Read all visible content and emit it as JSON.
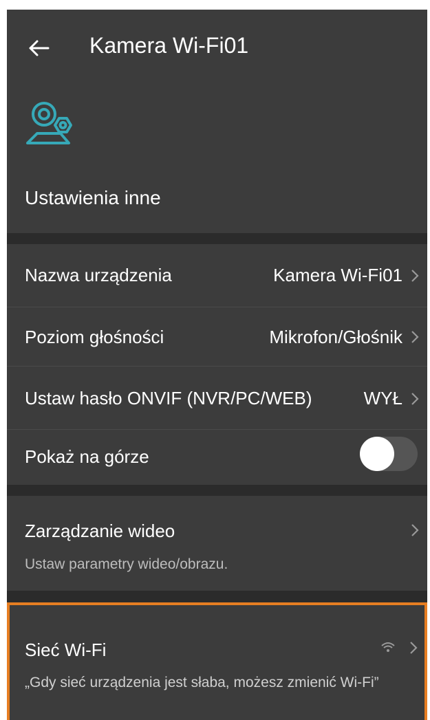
{
  "header": {
    "title": "Kamera Wi-Fi01"
  },
  "section": {
    "title": "Ustawienia inne"
  },
  "rows": [
    {
      "label": "Nazwa urządzenia",
      "value": "Kamera Wi-Fi01"
    },
    {
      "label": "Poziom głośności",
      "value": "Mikrofon/Głośnik"
    },
    {
      "label": "Ustaw hasło ONVIF (NVR/PC/WEB)",
      "value": "WYŁ"
    },
    {
      "label": "Pokaż na górze",
      "toggle": false
    }
  ],
  "video": {
    "label": "Zarządzanie wideo",
    "subtitle": "Ustaw parametry wideo/obrazu."
  },
  "wifi": {
    "label": "Sieć Wi-Fi",
    "subtitle": "„Gdy sieć urządzenia jest słaba, możesz zmienić Wi-Fi”",
    "highlight_color": "#e67e22"
  },
  "colors": {
    "background": "#3c3c3c",
    "divider": "#2b2b2b",
    "accent_icon": "#36a9b8"
  },
  "icons": [
    "back-arrow-icon",
    "camera-settings-icon",
    "chevron-right-icon",
    "wifi-signal-icon"
  ]
}
